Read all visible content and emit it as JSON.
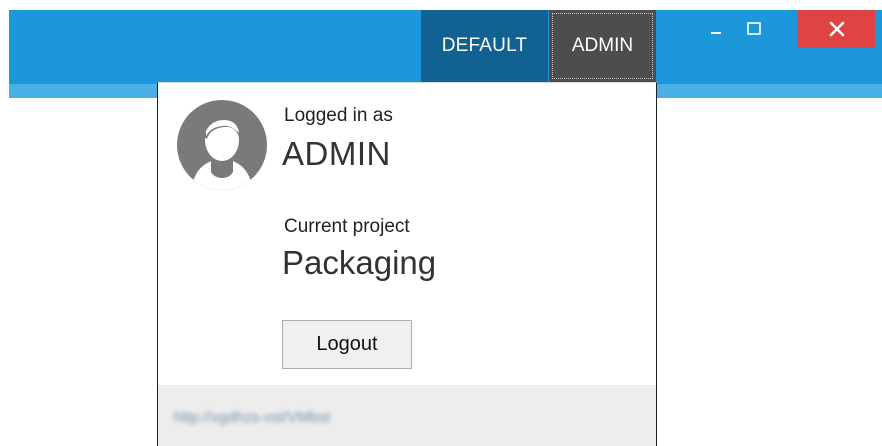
{
  "window": {
    "tabs": [
      "DEFAULT",
      "ADMIN"
    ],
    "minimize_glyph": "–",
    "maximize_glyph": "□",
    "close_glyph": "✕"
  },
  "account_panel": {
    "logged_in_label": "Logged in as",
    "user_name": "ADMIN",
    "current_project_label": "Current project",
    "project_name": "Packaging",
    "logout_label": "Logout",
    "server_url": "http://vgdhzs-vst/VMbst"
  },
  "icons": {
    "avatar": "user-avatar-icon",
    "minimize": "minimize-icon",
    "maximize": "maximize-icon",
    "close": "close-icon"
  },
  "colors": {
    "titlebar": "#1c97d9",
    "titlebar_accent": "#49b0e6",
    "tab_default_bg": "#116292",
    "tab_admin_bg": "#4d4d4d",
    "close_button": "#e04343"
  }
}
